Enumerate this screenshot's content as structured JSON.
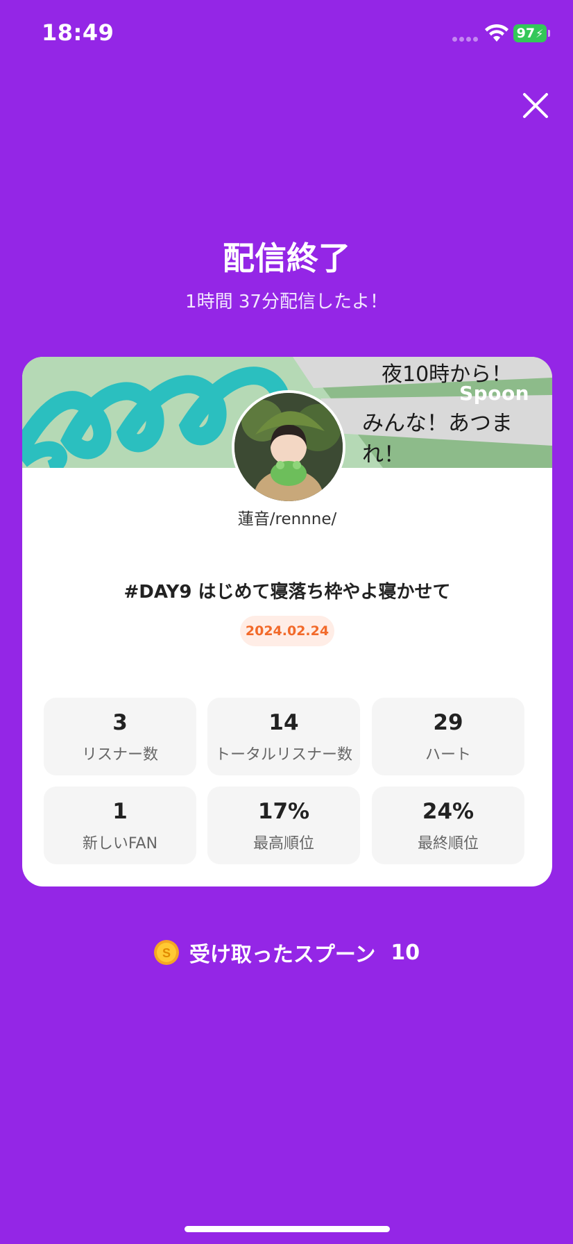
{
  "status_bar": {
    "time": "18:49",
    "battery": "97"
  },
  "header": {
    "title": "配信終了",
    "subtitle": "1時間 37分配信したよ！"
  },
  "card": {
    "banner": {
      "line1": "夜10時から！",
      "brand": "Spoon",
      "line2": "みんな！あつまれ！"
    },
    "username": "蓮音/rennne/",
    "stream_title": "#DAY9 はじめて寝落ち枠やよ寝かせて",
    "date": "2024.02.24",
    "stats": [
      {
        "value": "3",
        "label": "リスナー数"
      },
      {
        "value": "14",
        "label": "トータルリスナー数"
      },
      {
        "value": "29",
        "label": "ハート"
      },
      {
        "value": "1",
        "label": "新しいFAN"
      },
      {
        "value": "17%",
        "label": "最高順位"
      },
      {
        "value": "24%",
        "label": "最終順位"
      }
    ]
  },
  "spoons": {
    "label": "受け取ったスプーン",
    "count": "10"
  },
  "colors": {
    "background": "#9426E6",
    "accent_orange": "#F26A2A",
    "battery": "#34C759"
  }
}
